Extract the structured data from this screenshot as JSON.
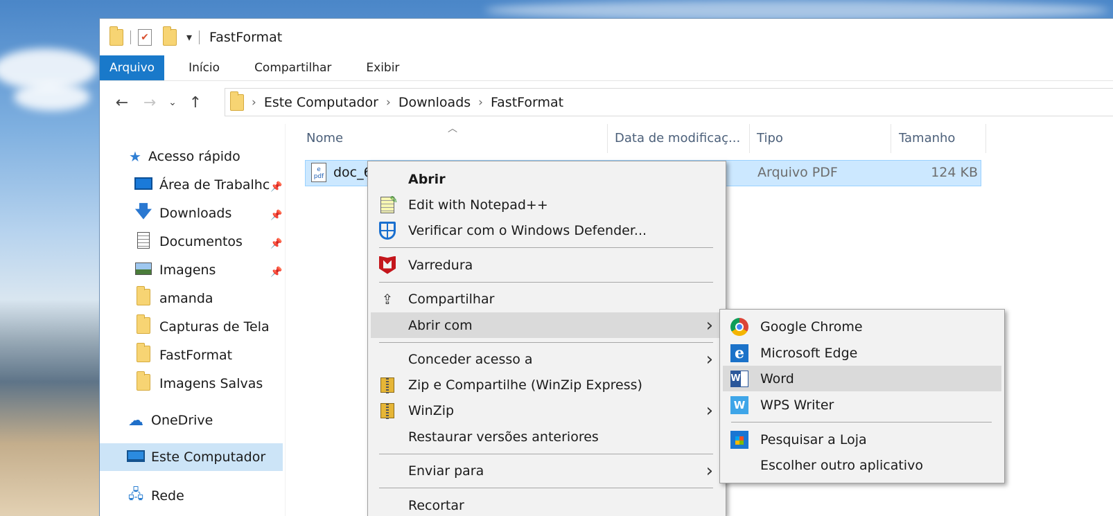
{
  "window": {
    "title": "FastFormat",
    "qat_dropdown": "▾"
  },
  "ribbon": {
    "tabs": [
      "Arquivo",
      "Início",
      "Compartilhar",
      "Exibir"
    ]
  },
  "address": {
    "breadcrumbs": [
      "Este Computador",
      "Downloads",
      "FastFormat"
    ]
  },
  "nav_pane": {
    "quick_access": "Acesso rápido",
    "items": [
      {
        "label": "Área de Trabalhc",
        "icon": "desktop-icon",
        "pinned": true
      },
      {
        "label": "Downloads",
        "icon": "download-arrow-icon",
        "pinned": true
      },
      {
        "label": "Documentos",
        "icon": "documents-icon",
        "pinned": true
      },
      {
        "label": "Imagens",
        "icon": "pictures-icon",
        "pinned": true
      },
      {
        "label": "amanda",
        "icon": "folder-icon",
        "pinned": false
      },
      {
        "label": "Capturas de Tela",
        "icon": "folder-icon",
        "pinned": false
      },
      {
        "label": "FastFormat",
        "icon": "folder-icon",
        "pinned": false
      },
      {
        "label": "Imagens Salvas",
        "icon": "folder-icon",
        "pinned": false
      }
    ],
    "onedrive": "OneDrive",
    "this_pc": "Este Computador",
    "network": "Rede"
  },
  "file_list": {
    "columns": [
      "Nome",
      "Data de modificaç...",
      "Tipo",
      "Tamanho"
    ],
    "rows": [
      {
        "name": "doc_6",
        "type": "Arquivo PDF",
        "size": "124 KB"
      }
    ]
  },
  "context_menu": {
    "items": [
      "Abrir",
      "Edit with Notepad++",
      "Verificar com o Windows Defender...",
      "Varredura",
      "Compartilhar",
      "Abrir com",
      "Conceder acesso a",
      "Zip e Compartilhe (WinZip Express)",
      "WinZip",
      "Restaurar versões anteriores",
      "Enviar para",
      "Recortar"
    ]
  },
  "submenu": {
    "items": [
      "Google Chrome",
      "Microsoft Edge",
      "Word",
      "WPS Writer",
      "Pesquisar a Loja",
      "Escolher outro aplicativo"
    ],
    "highlighted": "Word"
  },
  "colors": {
    "accent": "#1979ca",
    "selection": "#cce8ff",
    "menu_bg": "#f2f2f2"
  }
}
